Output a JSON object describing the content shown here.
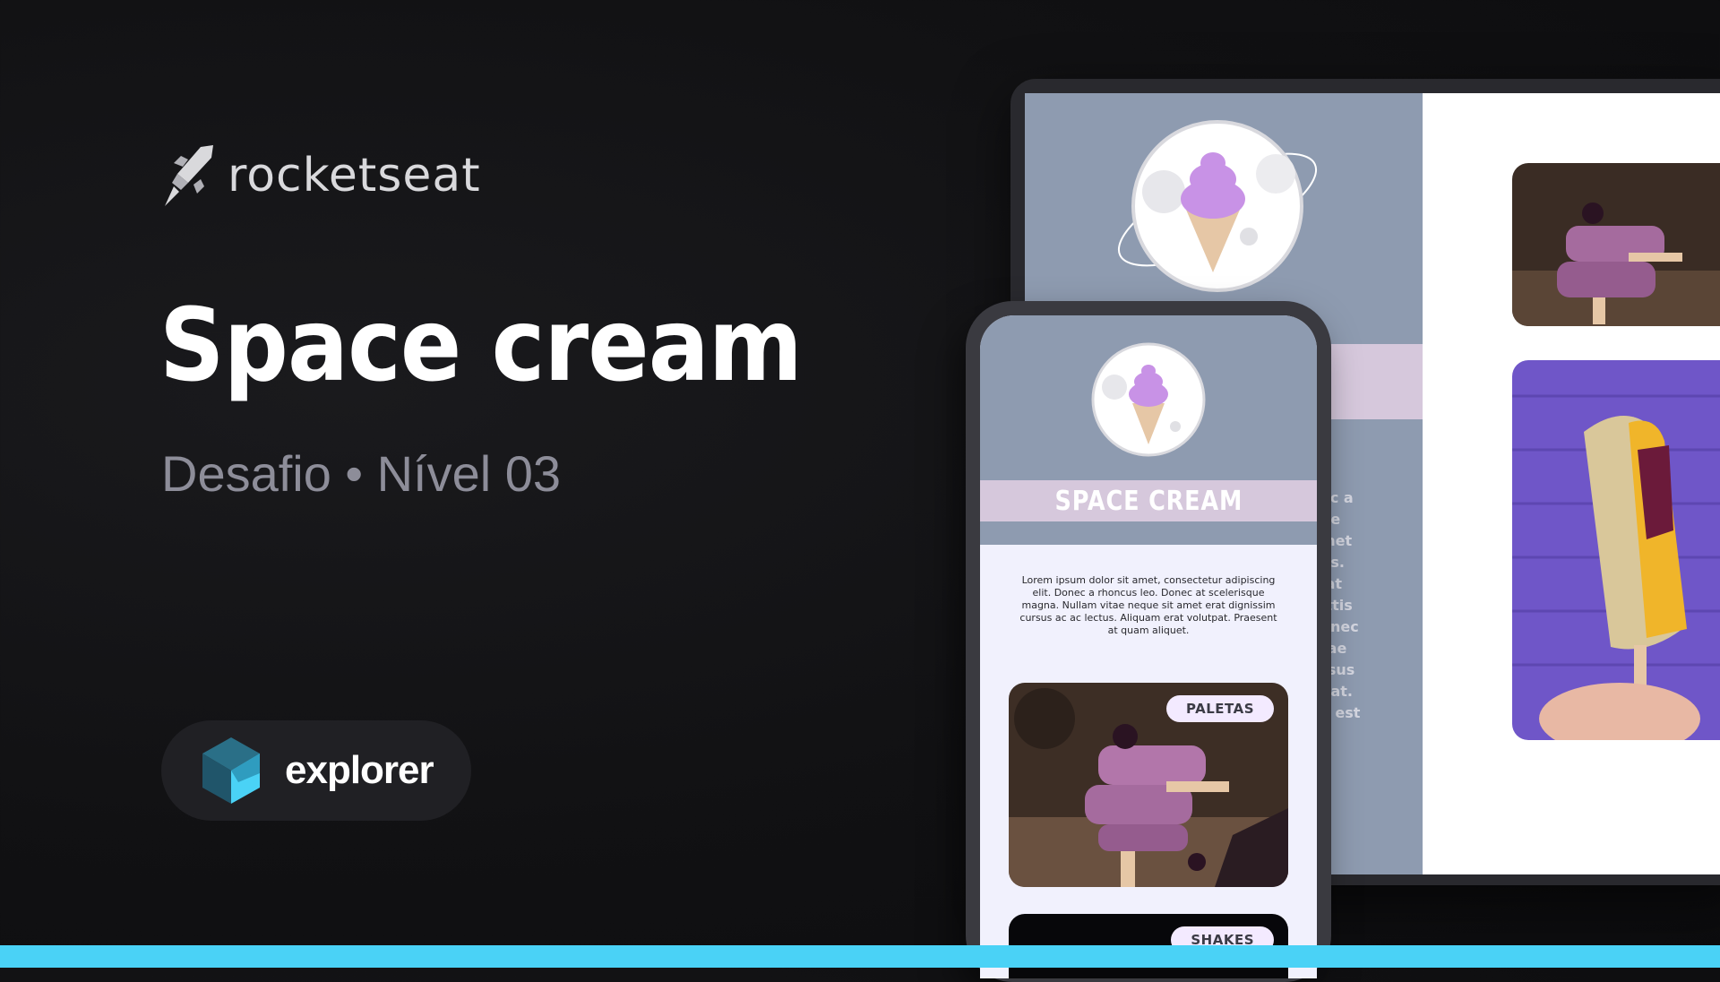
{
  "brand": {
    "name": "rocketseat",
    "icon": "rocket-icon"
  },
  "hero": {
    "title": "Space cream",
    "subtitle": "Desafio • Nível 03"
  },
  "badge": {
    "label": "explorer",
    "icon": "explorer-cube-icon"
  },
  "colors": {
    "accent": "#4ad2f6",
    "brand_text": "#d9d9dc",
    "subtitle": "#8d8d99",
    "pill_bg": "#202024",
    "site_slate": "#8e9bb0",
    "site_band": "#d6c8dc",
    "site_bg": "#f1f1fd",
    "icecream_purple": "#c892e6"
  },
  "mobile_site": {
    "title": "SPACE CREAM",
    "intro": "Lorem ipsum dolor sit amet, consectetur adipiscing elit. Donec a rhoncus leo. Donec at scelerisque magna. Nullam vitae neque sit amet erat dignissim cursus ac ac lectus. Aliquam erat volutpat. Praesent at quam aliquet.",
    "cards": [
      {
        "tag": "PALETAS",
        "image": "purple-popsicles-photo"
      },
      {
        "tag": "SHAKES",
        "image": "shakes-photo"
      }
    ]
  },
  "desktop_site": {
    "text_fragment": "ec a\nue\nmet\nus.\n at\nittis\nonec\ntae\nrsus\npat.\na est",
    "images": [
      "purple-popsicles-photo",
      "nut-popsicle-photo"
    ]
  }
}
